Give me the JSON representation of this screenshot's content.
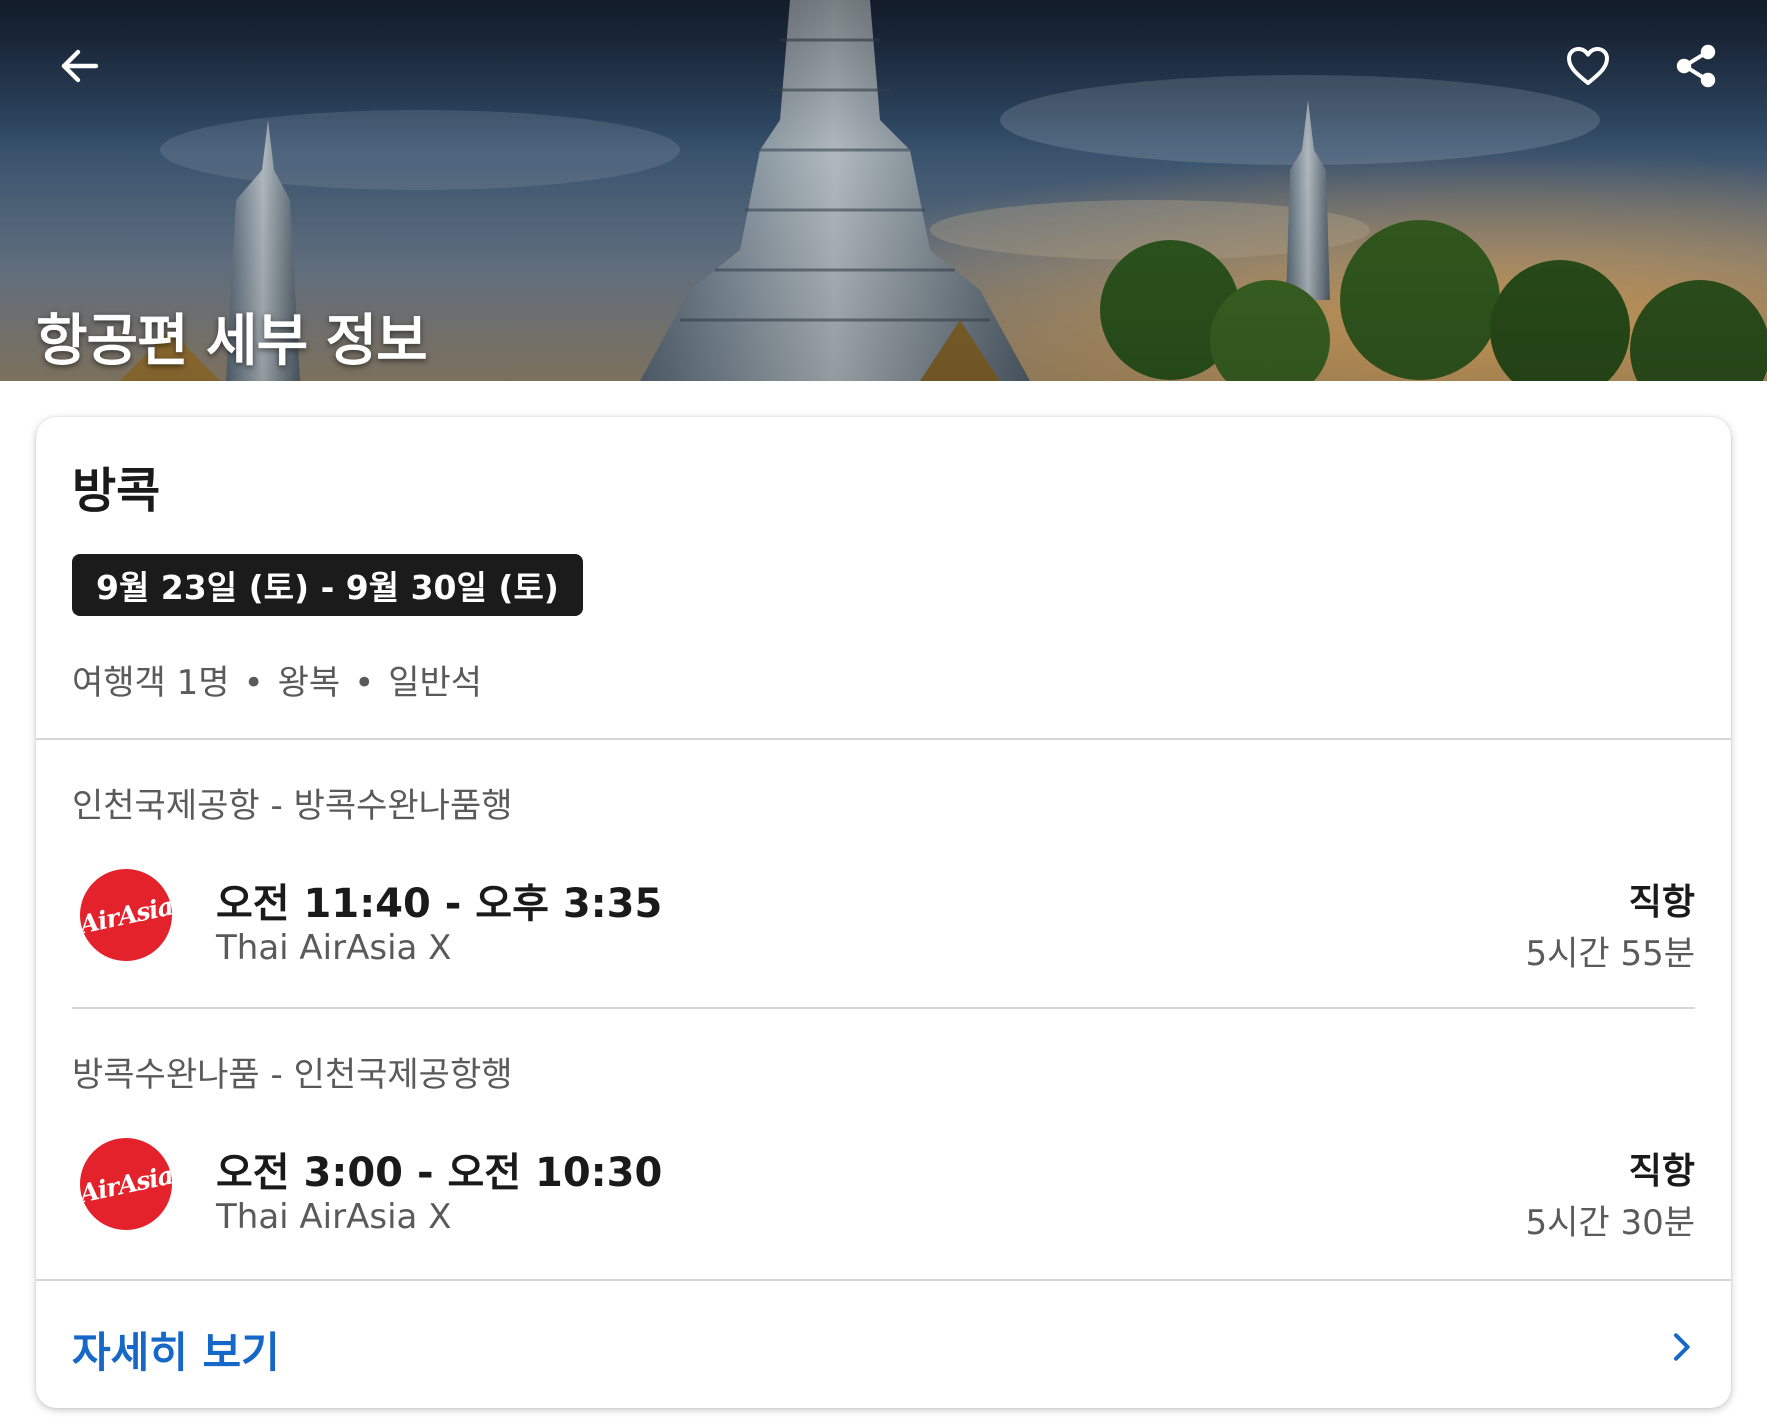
{
  "header": {
    "title": "항공편 세부 정보",
    "back_icon": "arrow-left-icon",
    "favorite_icon": "heart-outline-icon",
    "share_icon": "share-icon"
  },
  "trip": {
    "destination": "방콕",
    "dates": "9월 23일 (토) - 9월 30일 (토)",
    "travelers": "여행객 1명",
    "trip_type": "왕복",
    "cabin": "일반석",
    "separator": "•"
  },
  "flights": [
    {
      "route": "인천국제공항 - 방콕수완나품행",
      "airline_logo_text": "AirAsia",
      "times": "오전 11:40 - 오후 3:35",
      "airline": "Thai AirAsia X",
      "stops": "직항",
      "duration": "5시간 55분"
    },
    {
      "route": "방콕수완나품 - 인천국제공항행",
      "airline_logo_text": "AirAsia",
      "times": "오전 3:00 - 오전 10:30",
      "airline": "Thai AirAsia X",
      "stops": "직항",
      "duration": "5시간 30분"
    }
  ],
  "footer": {
    "details_label": "자세히 보기",
    "chevron_icon": "chevron-right-icon"
  },
  "colors": {
    "link": "#1668c8",
    "airline_brand": "#e4222b",
    "chip_bg": "#1b1b1b"
  }
}
